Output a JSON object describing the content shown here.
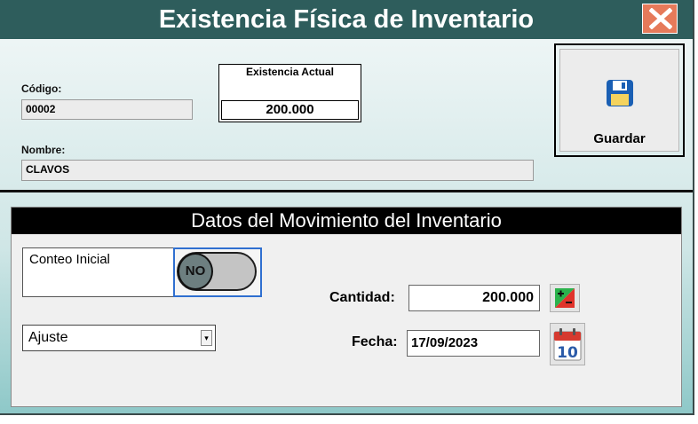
{
  "window": {
    "title": "Existencia Física de Inventario",
    "close_icon": "close-x-icon"
  },
  "header": {
    "codigo_label": "Código:",
    "codigo_value": "00002",
    "existencia_label": "Existencia Actual",
    "existencia_value": "200.000",
    "nombre_label": "Nombre:",
    "nombre_value": "CLAVOS"
  },
  "save_button": {
    "label": "Guardar",
    "icon": "floppy-disk-icon"
  },
  "movimiento": {
    "title": "Datos del Movimiento del Inventario",
    "conteo_label": "Conteo Inicial",
    "toggle_state": "NO",
    "tipo_selected": "Ajuste",
    "cantidad_label": "Cantidad:",
    "cantidad_value": "200.000",
    "calc_icon": "plus-minus-icon",
    "fecha_label": "Fecha:",
    "fecha_value": "17/09/2023",
    "calendar_icon": "calendar-icon",
    "calendar_day": "10"
  },
  "colors": {
    "titlebar": "#2e5d5c",
    "close_button": "#e67a5a",
    "panel_header": "#000000",
    "toggle_knob": "#6d7f80",
    "toggle_focus": "#2f6fd0"
  }
}
